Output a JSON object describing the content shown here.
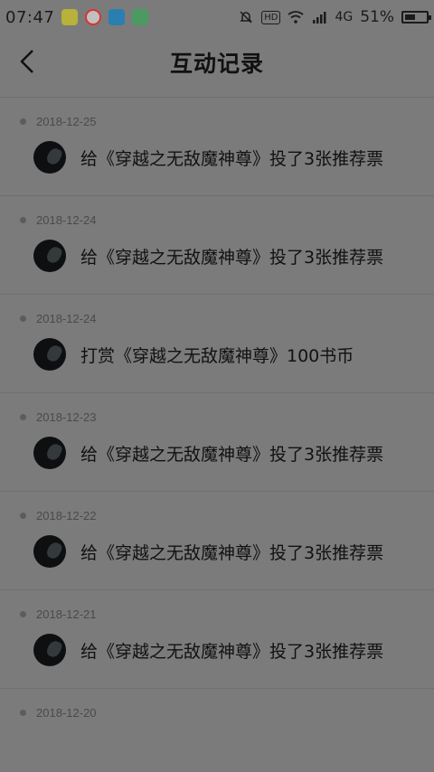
{
  "status_bar": {
    "time": "07:47",
    "hd": "HD",
    "network": "4G",
    "battery": "51%",
    "battery_level": 0.51,
    "icons": [
      "app-icon-1",
      "app-icon-2",
      "app-icon-3",
      "app-icon-4",
      "bell-off-icon",
      "wifi-icon",
      "signal-icon"
    ]
  },
  "header": {
    "title": "互动记录",
    "back_icon": "chevron-left-icon"
  },
  "records": [
    {
      "date": "",
      "text": "给《穿越之无敌魔神尊》投了3张推荐票"
    },
    {
      "date": "2018-12-25",
      "text": "给《穿越之无敌魔神尊》投了3张推荐票"
    },
    {
      "date": "2018-12-24",
      "text": "给《穿越之无敌魔神尊》投了3张推荐票"
    },
    {
      "date": "2018-12-24",
      "text": "打赏《穿越之无敌魔神尊》100书币"
    },
    {
      "date": "2018-12-23",
      "text": "给《穿越之无敌魔神尊》投了3张推荐票"
    },
    {
      "date": "2018-12-22",
      "text": "给《穿越之无敌魔神尊》投了3张推荐票"
    },
    {
      "date": "2018-12-21",
      "text": "给《穿越之无敌魔神尊》投了3张推荐票"
    },
    {
      "date": "2018-12-20",
      "text": ""
    }
  ]
}
